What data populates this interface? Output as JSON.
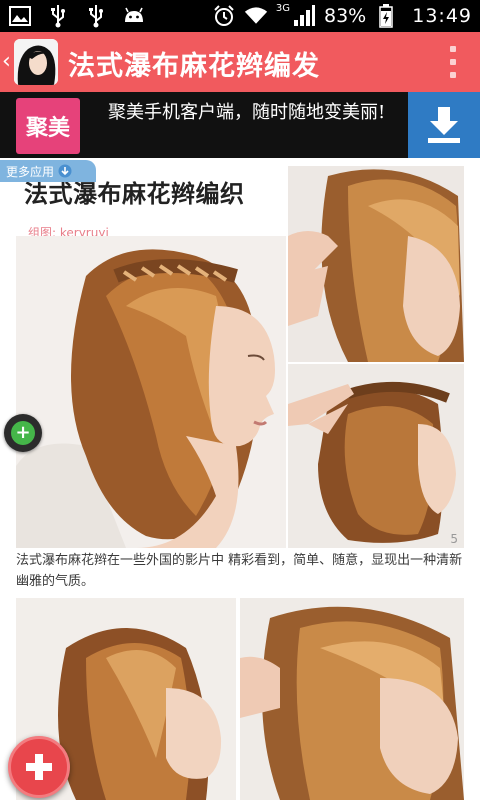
{
  "status_bar": {
    "battery": "83%",
    "time": "13:49",
    "network": "3G",
    "icons": [
      "image-icon",
      "usb-icon",
      "usb-icon",
      "android-icon",
      "alarm-icon",
      "wifi-icon",
      "signal-icon",
      "battery-icon"
    ]
  },
  "app_bar": {
    "title": "法式瀑布麻花辫编发",
    "back_icon": "chevron-left-icon",
    "menu_icon": "overflow-menu-icon",
    "color": "#f15a5e"
  },
  "ad": {
    "logo_text": "聚美",
    "text": "聚美手机客户端，随时随地变美丽!",
    "download_icon": "download-icon",
    "logo_color": "#e6427a",
    "button_color": "#2f7bc4"
  },
  "more_apps": {
    "label": "更多应用"
  },
  "article": {
    "image_title": "法式瀑布麻花辫编织",
    "image_credit": "组图: keryruyi",
    "page_number": "5",
    "caption": "法式瀑布麻花辫在一些外国的影片中 精彩看到，简单、随意，显现出一种清新幽雅的气质。"
  },
  "floating": {
    "small_button_icon": "plus-icon",
    "fab_icon": "plus-icon",
    "fab_color": "#e8464c"
  }
}
